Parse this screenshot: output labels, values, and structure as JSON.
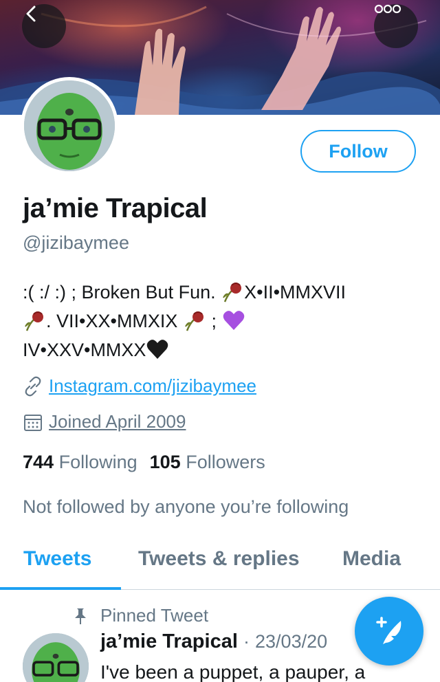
{
  "header": {
    "back_icon": "chevron-left-icon",
    "more_icon": "more-horizontal-icon"
  },
  "profile": {
    "follow_label": "Follow",
    "display_name": "ja’mie Trapical",
    "handle": "@jizibaymee",
    "bio_line1_a": ":( :/ :) ; Broken But Fun.",
    "bio_line1_b": "X•II•MMXVII",
    "bio_line2_a": ". VII•XX•MMXIX",
    "bio_line2_b": ";",
    "bio_line3": "IV•XXV•MMXX",
    "link": "Instagram.com/jizibaymee",
    "joined": "Joined April 2009",
    "following_count": "744",
    "following_label": "Following",
    "followers_count": "105",
    "followers_label": "Followers",
    "not_followed_text": "Not followed by anyone you’re following"
  },
  "tabs": {
    "tweets": "Tweets",
    "tweets_replies": "Tweets & replies",
    "media": "Media"
  },
  "pinned_tweet": {
    "pinned_label": "Pinned Tweet",
    "author": "ja’mie Trapical",
    "separator": "·",
    "date": "23/03/20",
    "text": "I've been a puppet, a pauper, a"
  },
  "colors": {
    "accent": "#1da1f2",
    "secondary_text": "#657786",
    "primary_text": "#14171a"
  }
}
